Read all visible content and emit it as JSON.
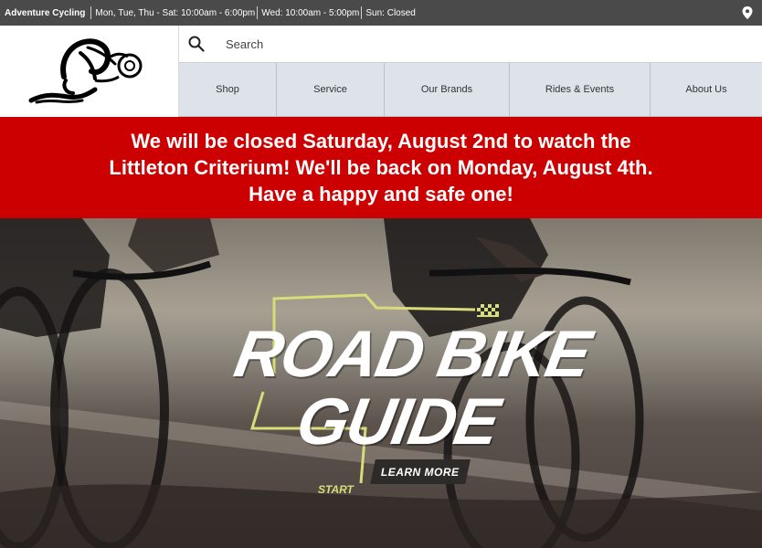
{
  "topbar": {
    "store_name": "Adventure Cycling",
    "hours": [
      "Mon, Tue, Thu - Sat: 10:00am - 6:00pm",
      "Wed: 10:00am - 5:00pm",
      "Sun: Closed"
    ]
  },
  "search": {
    "placeholder": "Search"
  },
  "nav": {
    "items": [
      "Shop",
      "Service",
      "Our Brands",
      "Rides & Events",
      "About Us"
    ]
  },
  "alert": {
    "lines": [
      "We will be closed Saturday, August 2nd to watch the",
      "Littleton Criterium! We'll be back on Monday, August 4th.",
      "Have a happy and safe one!"
    ]
  },
  "hero": {
    "headline_line1": "ROAD BIKE",
    "headline_line2": "GUIDE",
    "button_label": "LEARN MORE",
    "start_label": "START"
  },
  "colors": {
    "topbar": "#4a4a4a",
    "alert": "#cc0000",
    "nav": "#dde3e9",
    "route": "#d8dc7a"
  }
}
